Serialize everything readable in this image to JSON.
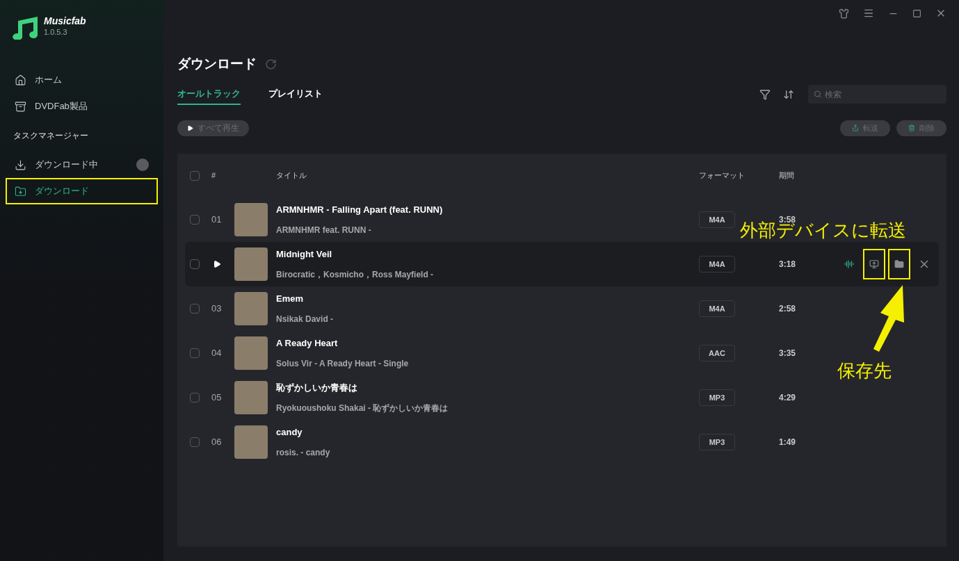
{
  "app": {
    "name": "Musicfab",
    "version": "1.0.5.3"
  },
  "sidebar": {
    "items": [
      {
        "label": "ホーム",
        "kind": "home",
        "selected": false,
        "highlighted": false
      },
      {
        "label": "DVDFab製品",
        "kind": "box",
        "selected": false,
        "highlighted": false
      }
    ],
    "section": "タスクマネージャー",
    "tasks": [
      {
        "label": "ダウンロード中",
        "kind": "downloading",
        "selected": false,
        "highlighted": false,
        "badge": true
      },
      {
        "label": "ダウンロード",
        "kind": "downloaded",
        "selected": true,
        "highlighted": true,
        "badge": false
      }
    ]
  },
  "page": {
    "title": "ダウンロード",
    "tabs": [
      {
        "label": "オールトラック",
        "selected": true
      },
      {
        "label": "プレイリスト",
        "selected": false
      }
    ],
    "search": {
      "placeholder": "検索"
    },
    "play_all": {
      "label": "すべて再生",
      "disabled": true
    },
    "actions": [
      {
        "label": "転送",
        "kind": "transfer",
        "disabled": true
      },
      {
        "label": "削除",
        "kind": "delete",
        "disabled": true
      }
    ]
  },
  "table": {
    "header": {
      "checked": false,
      "number": "#",
      "title": "タイトル",
      "format": "フォーマット",
      "duration": "期間"
    },
    "rows": [
      {
        "number": "01",
        "title": "ARMNHMR - Falling Apart (feat. RUNN)",
        "subtitle": "ARMNHMR feat. RUNN -",
        "format": "M4A",
        "duration": "3:58",
        "checked": false,
        "hovered": false
      },
      {
        "title": "Midnight Veil",
        "subtitle": "Birocratic，Kosmicho，Ross Mayfield -",
        "format": "M4A",
        "duration": "3:18",
        "checked": false,
        "hovered": true,
        "row_actions": [
          {
            "kind": "wave",
            "highlighted": false
          },
          {
            "kind": "transfer",
            "highlighted": true
          },
          {
            "kind": "folder",
            "highlighted": true
          },
          {
            "kind": "close",
            "highlighted": false
          }
        ]
      },
      {
        "number": "03",
        "title": "Emem",
        "subtitle": "Nsikak David -",
        "format": "M4A",
        "duration": "2:58",
        "checked": false,
        "hovered": false
      },
      {
        "number": "04",
        "title": "A Ready Heart",
        "subtitle": "Solus Vir - A Ready Heart - Single",
        "format": "AAC",
        "duration": "3:35",
        "checked": false,
        "hovered": false
      },
      {
        "number": "05",
        "title": "恥ずかしいか青春は",
        "subtitle": "Ryokuoushoku Shakai - 恥ずかしいか青春は",
        "format": "MP3",
        "duration": "4:29",
        "checked": false,
        "hovered": false
      },
      {
        "number": "06",
        "title": "candy",
        "subtitle": "rosis. - candy",
        "format": "MP3",
        "duration": "1:49",
        "checked": false,
        "hovered": false
      }
    ]
  },
  "annotations": [
    {
      "text": "外部デバイスに転送",
      "kind": "transfer"
    },
    {
      "text": "保存先",
      "kind": "folder"
    }
  ]
}
